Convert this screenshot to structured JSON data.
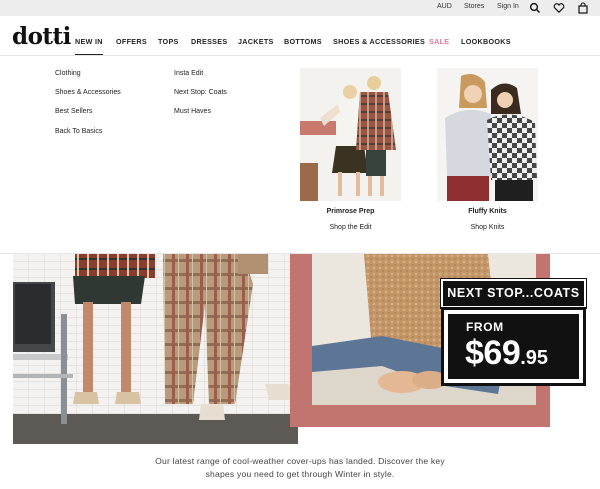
{
  "utility_bar": {
    "currency": "AUD",
    "stores": "Stores",
    "sign_in": "Sign In",
    "icons": [
      "search-icon",
      "heart-icon",
      "bag-icon"
    ]
  },
  "brand": {
    "logo": "dotti",
    "logo_mark": "®"
  },
  "nav": {
    "items": [
      "NEW IN",
      "OFFERS",
      "TOPS",
      "DRESSES",
      "JACKETS",
      "BOTTOMS",
      "SHOES & ACCESSORIES",
      "SALE",
      "LOOKBOOKS"
    ],
    "active": "NEW IN",
    "sale_color": "#e8769b"
  },
  "mega_menu": {
    "column_1": [
      "Clothing",
      "Shoes & Accessories",
      "Best Sellers",
      "Back To Basics"
    ],
    "column_2": [
      "Insta Edit",
      "Next Stop: Coats",
      "Must Haves"
    ],
    "promos": [
      {
        "title": "Primrose Prep",
        "cta": "Shop the Edit"
      },
      {
        "title": "Fluffy Knits",
        "cta": "Shop Knits"
      }
    ]
  },
  "hero": {
    "headline": "NEXT STOP...COATS",
    "from_label": "FROM",
    "price_dollars": "$69",
    "price_cents": ".95",
    "accent_color": "#c2756e",
    "tagline": "Our latest range of cool-weather cover-ups has landed. Discover the key shapes you need to get through Winter in style."
  }
}
